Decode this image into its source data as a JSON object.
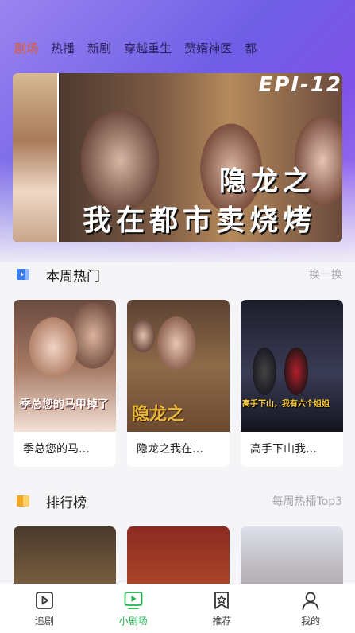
{
  "tabs": [
    "剧场",
    "热播",
    "新剧",
    "穿越重生",
    "赘婿神医",
    "都"
  ],
  "active_tab_index": 0,
  "banner": {
    "episode_badge": "EPI-12",
    "title_line1": "隐龙之",
    "title_line2": "我在都市卖烧烤"
  },
  "weekly_hot": {
    "title": "本周热门",
    "action": "换一换",
    "items": [
      {
        "title": "季总您的马…",
        "poster_text": "季总您的马甲掉了"
      },
      {
        "title": "隐龙之我在…",
        "poster_text": "隐龙之"
      },
      {
        "title": "高手下山我…",
        "poster_text": "高手下山，我有六个姐姐"
      }
    ]
  },
  "ranking": {
    "title": "排行榜",
    "action": "每周热播Top3"
  },
  "bottom_nav": [
    {
      "label": "追剧",
      "icon": "play-square-icon"
    },
    {
      "label": "小剧场",
      "icon": "tv-play-icon"
    },
    {
      "label": "推荐",
      "icon": "star-bookmark-icon"
    },
    {
      "label": "我的",
      "icon": "user-icon"
    }
  ],
  "active_nav_index": 1,
  "colors": {
    "active_tab": "#e25a2a",
    "active_nav": "#22b24c",
    "hot_icon": "#3b7cf5",
    "rank_icon": "#f5a623"
  }
}
